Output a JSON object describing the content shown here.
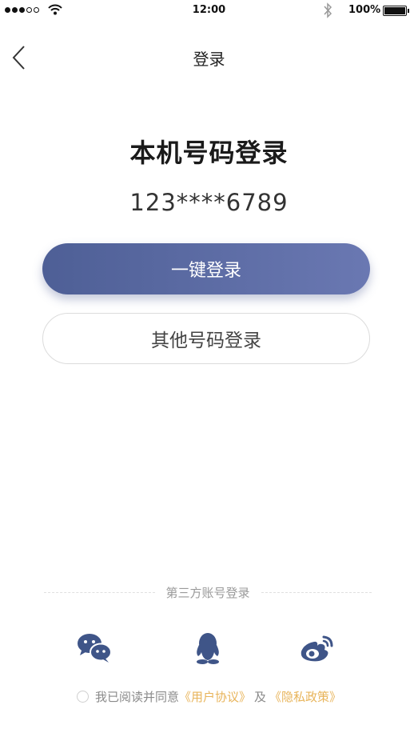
{
  "status_bar": {
    "time": "12:00",
    "battery_percent": "100%"
  },
  "nav": {
    "title": "登录"
  },
  "main": {
    "heading": "本机号码登录",
    "masked_phone": "123****6789",
    "one_click_login_label": "一键登录",
    "other_number_login_label": "其他号码登录"
  },
  "third_party": {
    "divider_label": "第三方账号登录",
    "providers": [
      "wechat-icon",
      "qq-icon",
      "weibo-icon"
    ]
  },
  "agreement": {
    "prefix": "我已阅读并同意",
    "user_agreement": "《用户协议》",
    "and": "及",
    "privacy_policy": "《隐私政策》",
    "checked": false
  },
  "colors": {
    "primary_start": "#4e5f96",
    "primary_end": "#6a78b2",
    "link": "#e8b45a",
    "icon": "#3f5588"
  }
}
